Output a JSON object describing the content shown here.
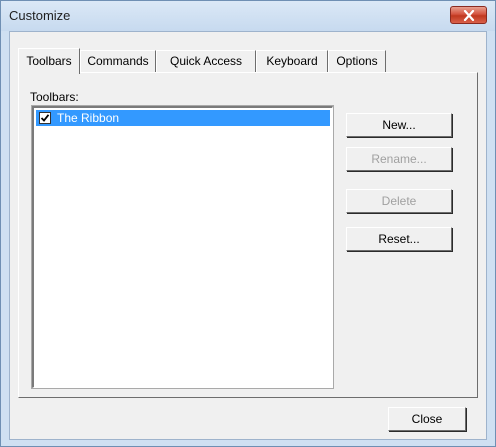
{
  "window": {
    "title": "Customize",
    "close_icon": "close-icon",
    "close_color": "#c7432d"
  },
  "tabs": [
    {
      "label": "Toolbars",
      "active": true
    },
    {
      "label": "Commands",
      "active": false
    },
    {
      "label": "Quick Access",
      "active": false
    },
    {
      "label": "Keyboard",
      "active": false
    },
    {
      "label": "Options",
      "active": false
    }
  ],
  "toolbars_panel": {
    "list_label": "Toolbars:",
    "items": [
      {
        "label": "The Ribbon",
        "checked": true,
        "selected": true
      }
    ],
    "selection_color": "#3399ff",
    "buttons": {
      "new": {
        "label": "New...",
        "enabled": true
      },
      "rename": {
        "label": "Rename...",
        "enabled": false
      },
      "delete": {
        "label": "Delete",
        "enabled": false
      },
      "reset": {
        "label": "Reset...",
        "enabled": true
      }
    }
  },
  "footer": {
    "close_label": "Close"
  }
}
